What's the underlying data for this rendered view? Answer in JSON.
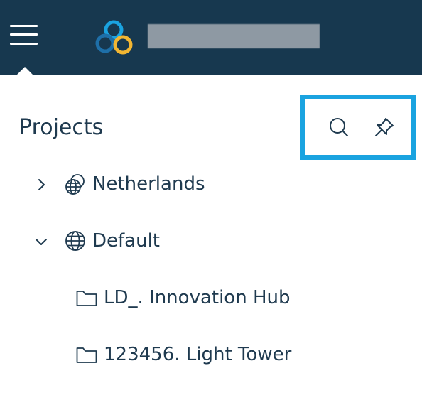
{
  "header": {
    "menu_icon": "hamburger-menu-icon",
    "logo_icon": "brand-logo-icon",
    "logo_colors": [
      "#1aa3e0",
      "#f2b632",
      "#1e6fa8"
    ],
    "app_title_redacted": true
  },
  "panel": {
    "title": "Projects",
    "tools": [
      {
        "name": "search",
        "icon": "search-icon"
      },
      {
        "name": "pin",
        "icon": "pin-icon"
      }
    ],
    "highlight_color": "#1aa3e0"
  },
  "tree": [
    {
      "label": "Netherlands",
      "icon": "globe-stack-icon",
      "expanded": false,
      "level": 0
    },
    {
      "label": "Default",
      "icon": "globe-icon",
      "expanded": true,
      "level": 0,
      "children": [
        {
          "label": "LD_. Innovation Hub",
          "icon": "folder-icon",
          "level": 1
        },
        {
          "label": "123456. Light Tower",
          "icon": "folder-icon",
          "level": 1
        }
      ]
    }
  ]
}
